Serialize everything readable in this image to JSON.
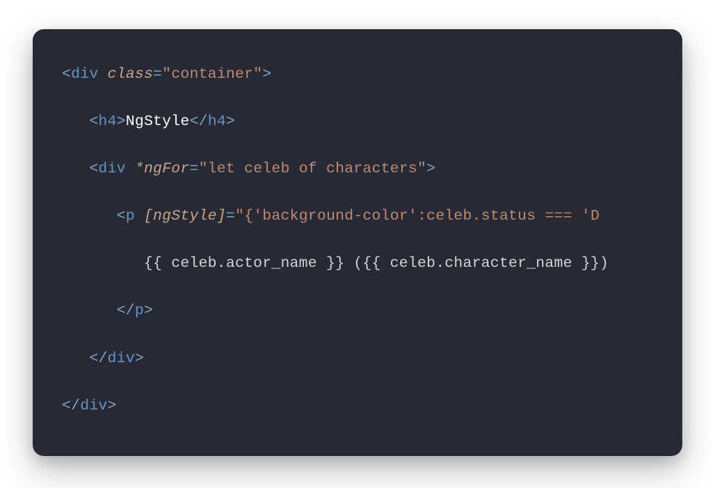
{
  "code": {
    "lines": [
      {
        "indent": 0,
        "tokens": [
          {
            "t": "punct",
            "v": "<"
          },
          {
            "t": "tag",
            "v": "div"
          },
          {
            "t": "text",
            "v": " "
          },
          {
            "t": "attr",
            "v": "class"
          },
          {
            "t": "equals",
            "v": "="
          },
          {
            "t": "string",
            "v": "\"container\""
          },
          {
            "t": "punct",
            "v": ">"
          }
        ]
      },
      {
        "indent": 1,
        "tokens": [
          {
            "t": "punct",
            "v": "<"
          },
          {
            "t": "tag",
            "v": "h4"
          },
          {
            "t": "punct",
            "v": ">"
          },
          {
            "t": "text-white",
            "v": "NgStyle"
          },
          {
            "t": "punct",
            "v": "</"
          },
          {
            "t": "tag",
            "v": "h4"
          },
          {
            "t": "punct",
            "v": ">"
          }
        ]
      },
      {
        "indent": 1,
        "tokens": [
          {
            "t": "punct",
            "v": "<"
          },
          {
            "t": "tag",
            "v": "div"
          },
          {
            "t": "text",
            "v": " "
          },
          {
            "t": "attr",
            "v": "*ngFor"
          },
          {
            "t": "equals",
            "v": "="
          },
          {
            "t": "string",
            "v": "\"let celeb of characters\""
          },
          {
            "t": "punct",
            "v": ">"
          }
        ]
      },
      {
        "indent": 2,
        "tokens": [
          {
            "t": "punct",
            "v": "<"
          },
          {
            "t": "tag",
            "v": "p"
          },
          {
            "t": "text",
            "v": " "
          },
          {
            "t": "attr",
            "v": "[ngStyle]"
          },
          {
            "t": "equals",
            "v": "="
          },
          {
            "t": "string",
            "v": "\"{'background-color':celeb.status === 'D"
          }
        ]
      },
      {
        "indent": 3,
        "tokens": [
          {
            "t": "template",
            "v": "{{ celeb.actor_name }} ({{ celeb.character_name }})"
          }
        ]
      },
      {
        "indent": 2,
        "tokens": [
          {
            "t": "punct",
            "v": "</"
          },
          {
            "t": "tag",
            "v": "p"
          },
          {
            "t": "punct",
            "v": ">"
          }
        ]
      },
      {
        "indent": 1,
        "tokens": [
          {
            "t": "punct",
            "v": "</"
          },
          {
            "t": "tag",
            "v": "div"
          },
          {
            "t": "punct",
            "v": ">"
          }
        ]
      },
      {
        "indent": 0,
        "tokens": [
          {
            "t": "punct",
            "v": "</"
          },
          {
            "t": "tag",
            "v": "div"
          },
          {
            "t": "punct",
            "v": ">"
          }
        ]
      }
    ]
  }
}
